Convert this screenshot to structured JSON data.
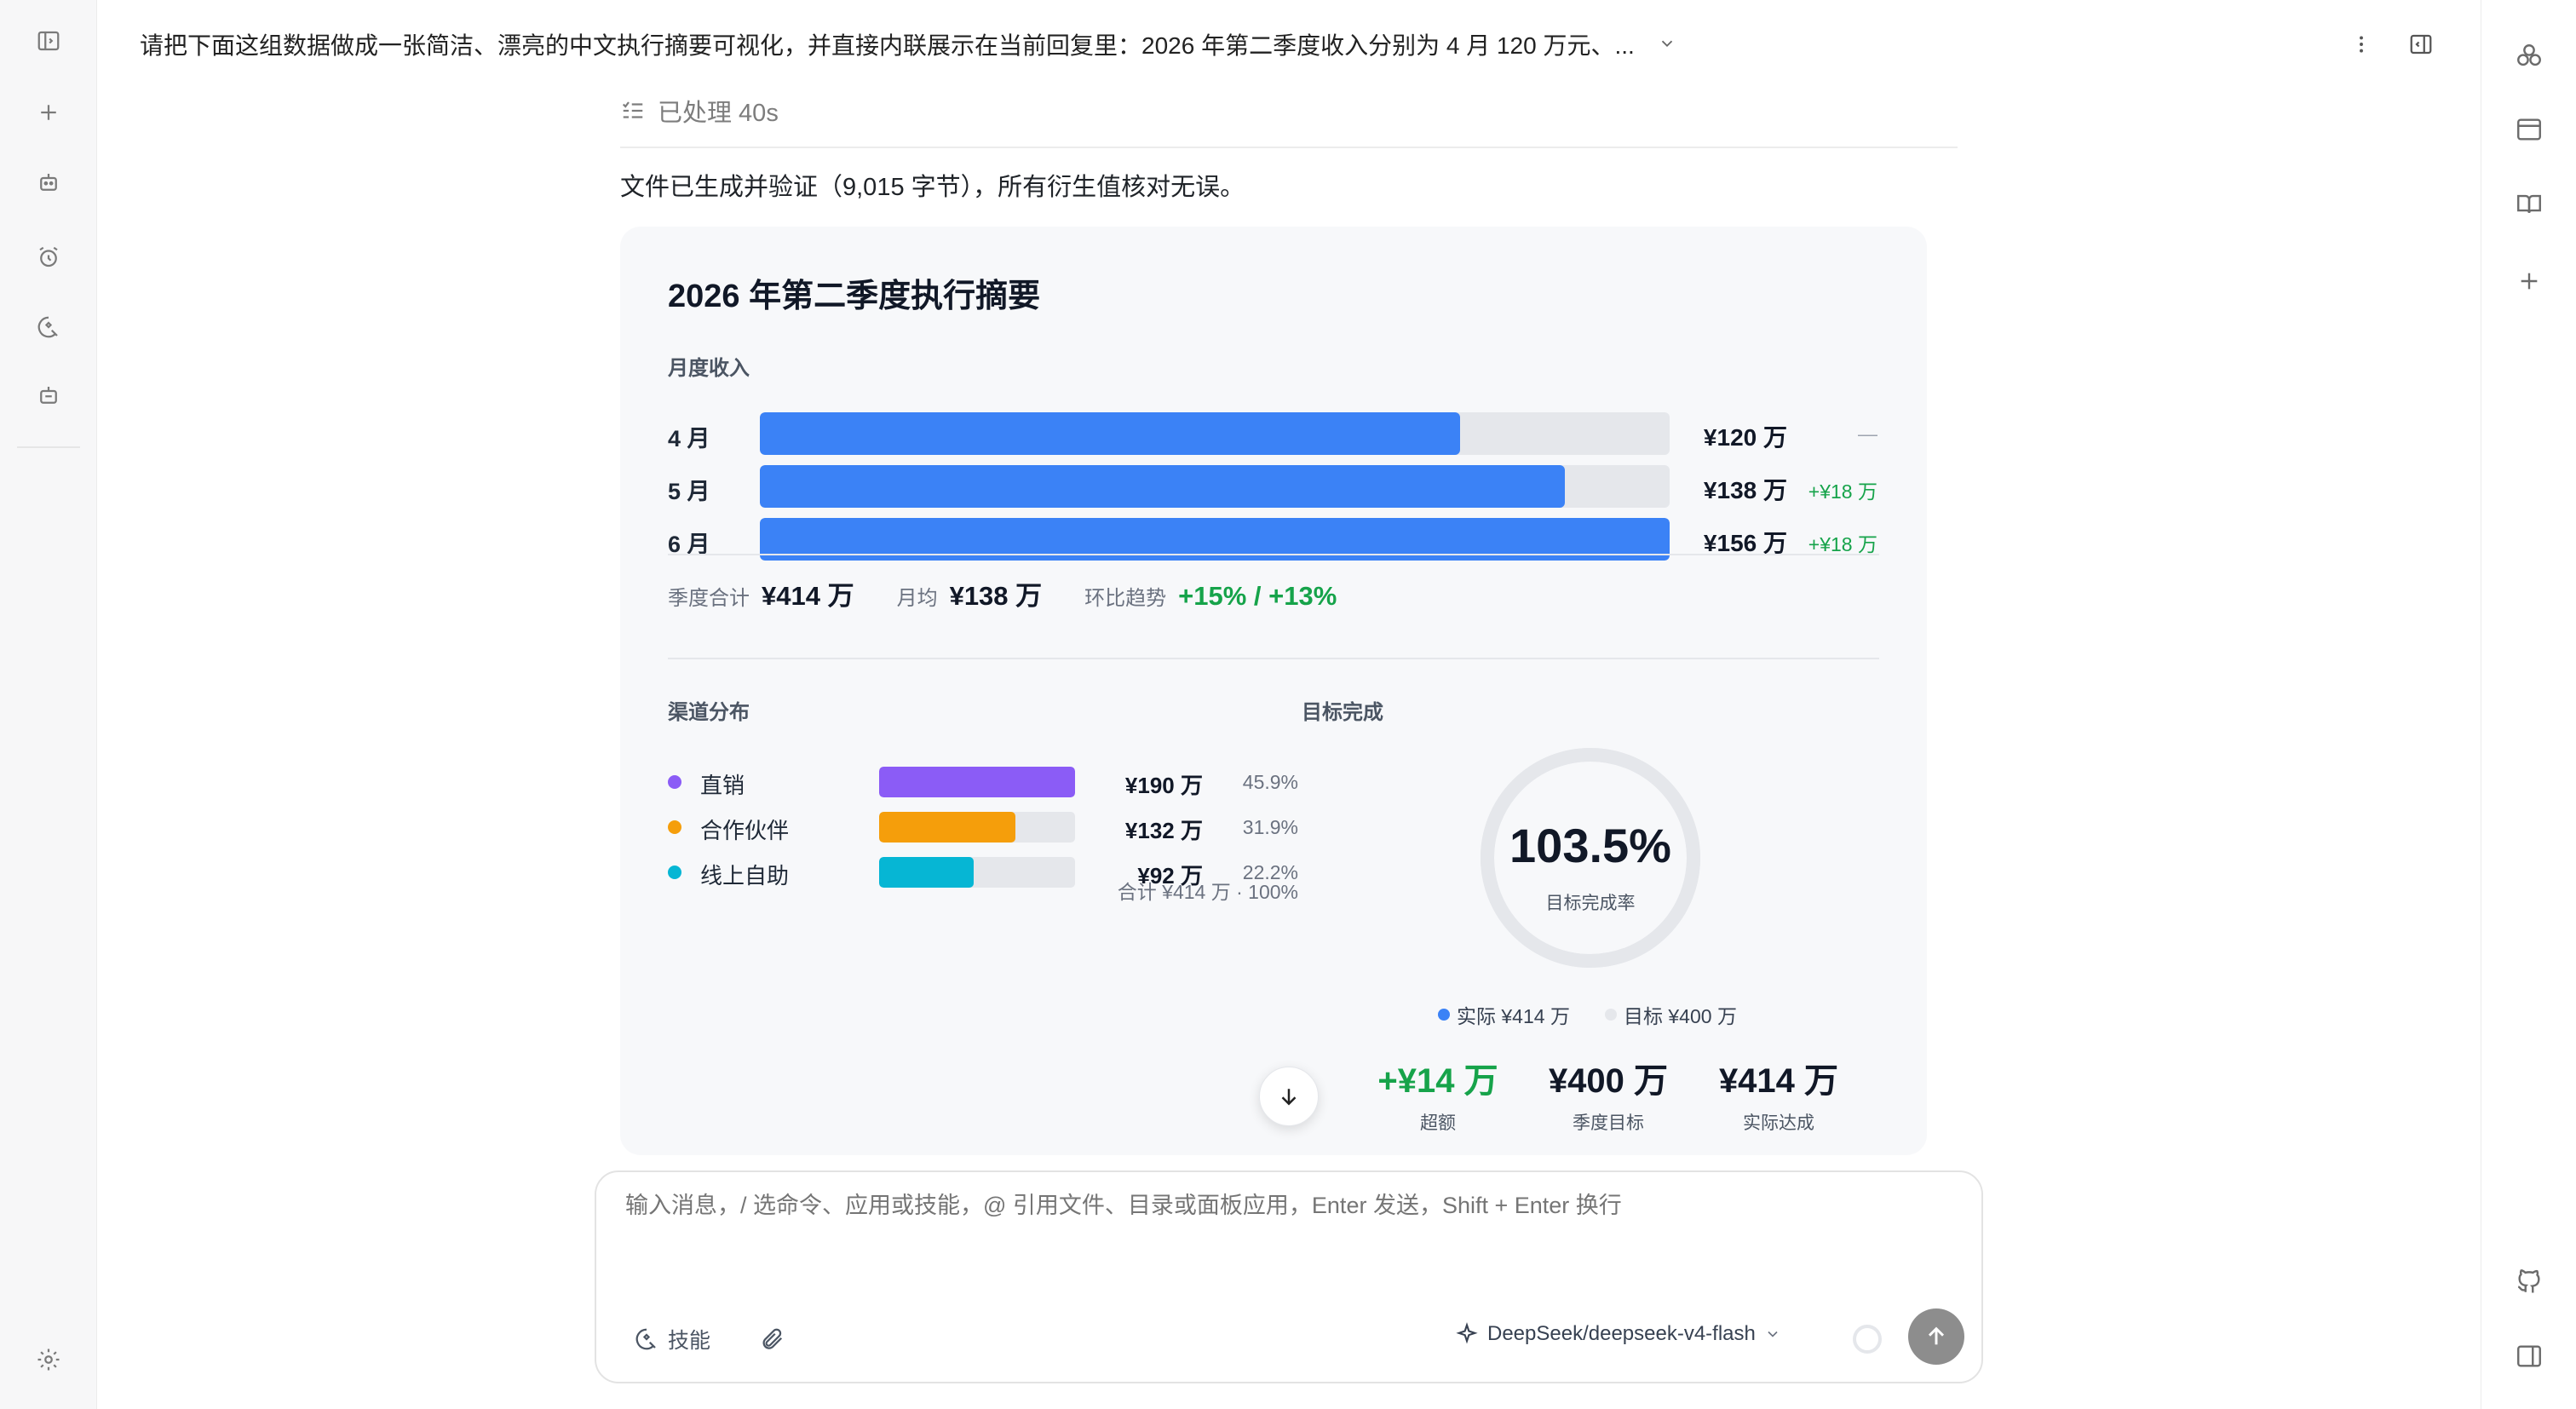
{
  "header": {
    "conversation_title": "请把下面这组数据做成一张简洁、漂亮的中文执行摘要可视化，并直接内联展示在当前回复里：2026 年第二季度收入分别为 4 月 120 万元、..."
  },
  "status": {
    "processed": "已处理 40s"
  },
  "message": {
    "text": "文件已生成并验证（9,015 字节），所有衍生值核对无误。"
  },
  "card": {
    "title": "2026 年第二季度执行摘要",
    "monthly_section": "月度收入",
    "monthly_max": 156,
    "months": [
      {
        "label": "4 月",
        "value": 120,
        "value_text": "¥120 万",
        "delta": "—"
      },
      {
        "label": "5 月",
        "value": 138,
        "value_text": "¥138 万",
        "delta": "+¥18 万"
      },
      {
        "label": "6 月",
        "value": 156,
        "value_text": "¥156 万",
        "delta": "+¥18 万"
      }
    ],
    "stats": {
      "total_label": "季度合计",
      "total_value": "¥414 万",
      "avg_label": "月均",
      "avg_value": "¥138 万",
      "trend_label": "环比趋势",
      "trend_value": "+15% / +13%"
    },
    "channel_section": "渠道分布",
    "channels": [
      {
        "name": "直销",
        "value_text": "¥190 万",
        "pct_text": "45.9%",
        "pct": 45.9,
        "color": "#8b5cf6"
      },
      {
        "name": "合作伙伴",
        "value_text": "¥132 万",
        "pct_text": "31.9%",
        "pct": 31.9,
        "color": "#f59e0b"
      },
      {
        "name": "线上自助",
        "value_text": "¥92 万",
        "pct_text": "22.2%",
        "pct": 22.2,
        "color": "#06b6d4"
      }
    ],
    "channel_total": "合计 ¥414 万 · 100%",
    "target_section": "目标完成",
    "gauge": {
      "value_text": "103.5%",
      "sub_label": "目标完成率",
      "actual_legend": "实际 ¥414 万",
      "target_legend": "目标 ¥400 万",
      "actual_color": "#3b82f6",
      "target_color": "#e5e7eb"
    },
    "kpis": [
      {
        "value": "+¥14 万",
        "label": "超额"
      },
      {
        "value": "¥400 万",
        "label": "季度目标"
      },
      {
        "value": "¥414 万",
        "label": "实际达成"
      }
    ],
    "bar_color": "#3b82f6"
  },
  "composer": {
    "placeholder": "输入消息，/ 选命令、应用或技能，@ 引用文件、目录或面板应用，Enter 发送，Shift + Enter 换行",
    "skills_label": "技能",
    "model": "DeepSeek/deepseek-v4-flash"
  }
}
